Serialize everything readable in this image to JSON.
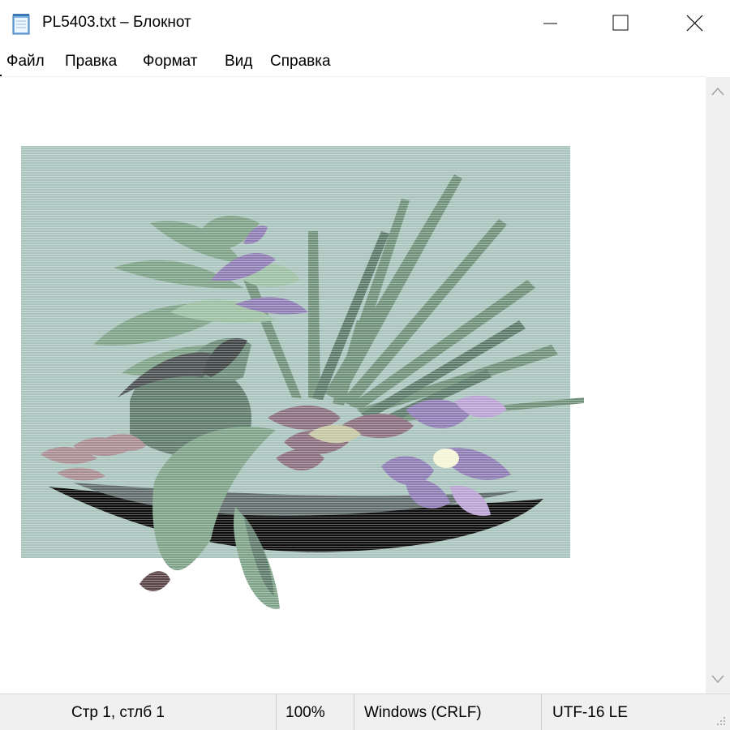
{
  "window": {
    "title": "PL5403.txt – Блокнот",
    "app_icon": "notepad-icon",
    "controls": [
      "minimize-icon",
      "maximize-icon",
      "close-icon"
    ]
  },
  "menu": {
    "items": [
      "Файл",
      "Правка",
      "Формат",
      "Вид",
      "Справка"
    ]
  },
  "editor": {
    "content": "ascii-art-image-of-tropical-plants-and-flowers",
    "colors": {
      "background_panel": "#a9c3bd",
      "leaf_dark": "#5d7a6a",
      "leaf_mid": "#7ea287",
      "leaf_light": "#9dbfa3",
      "purple": "#8d7bb3",
      "lilac": "#b9a1d3",
      "mauve": "#8a6e7e",
      "black": "#0d0d0d"
    }
  },
  "statusbar": {
    "position": "Стр 1, стлб 1",
    "zoom": "100%",
    "line_endings": "Windows (CRLF)",
    "encoding": "UTF-16 LE"
  },
  "scrollbar": {
    "up": "scroll-up-arrow-icon",
    "down": "scroll-down-arrow-icon"
  }
}
